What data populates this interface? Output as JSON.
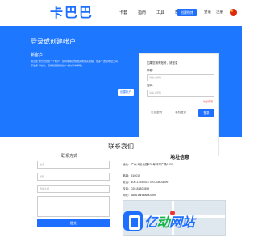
{
  "header": {
    "logo_chars": [
      "卡",
      "巴",
      "巴"
    ],
    "nav": [
      "卡套",
      "指南",
      "工具",
      "帮包"
    ],
    "cta": "创建微博",
    "login": "登录",
    "register": "注册"
  },
  "hero": {
    "title": "登录或创建帐户",
    "subtitle": "新客户",
    "text": "通过在卡巴巴创建一个帐户，您将能够更快地完成购买流程，在多个送货地址之间存储多个地址，查看和跟踪您帐户中的订单等等。",
    "create_button": "创建帐户"
  },
  "login": {
    "hint": "如果您拥有账号，请登录",
    "email_label": "邮箱：",
    "email_placeholder": "请输入邮箱",
    "password_label": "密码：",
    "password_placeholder": "请输入密码",
    "forgot": "* 为必填项",
    "forgot_password": "忘记密码",
    "phone_login": "手机登录",
    "login_button": "登录"
  },
  "contact": {
    "section_title": "联系我们",
    "form_title": "联系方式",
    "name_placeholder": "姓名",
    "email_placeholder": "邮箱",
    "select_placeholder": "选择主题",
    "submit": "提交"
  },
  "address": {
    "title": "地址信息",
    "location": "地址：广州人民北路829号环球广场1507",
    "postcode": "邮编：510012",
    "phone": "电话：400-1144001 / 020-83803899",
    "fax": "传真：020-83803899",
    "web": "网址：www.cardbaba.com",
    "map_link": "查看地图 / 复制地址"
  },
  "watermark": {
    "part1": "亿",
    "part2": "动",
    "part3": "网",
    "part4": "站"
  },
  "colors": {
    "primary": "#1e78ff",
    "accent_red": "#e33333"
  }
}
